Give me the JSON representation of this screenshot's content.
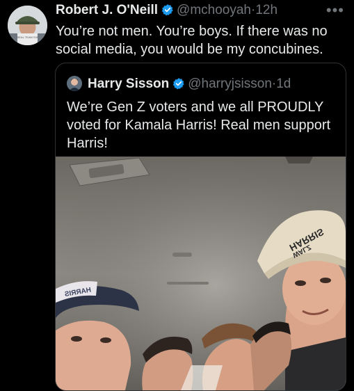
{
  "tweet": {
    "author_name": "Robert J. O'Neill",
    "handle": "@mchooyah",
    "separator": "·",
    "time": "12h",
    "more_icon": "more-icon",
    "text": "You’re not men. You’re boys. If there was no social media, you would be my concubines.",
    "avatar_cap_text": "SEAL TEAM SIX"
  },
  "quoted": {
    "author_name": "Harry Sisson",
    "handle": "@harryjsisson",
    "separator": "·",
    "time": "1d",
    "text": "We’re Gen Z voters and we all PROUDLY voted for Kamala Harris! Real men support Harris!",
    "photo": {
      "hat_right_text_1": "HARRIS",
      "hat_right_text_2": "WALZ",
      "hat_left_text": "HARRIS"
    }
  },
  "colors": {
    "background": "#000000",
    "text": "#e7e9ea",
    "secondary": "#71767b",
    "verified": "#1d9bf0",
    "border": "#2f3336"
  }
}
